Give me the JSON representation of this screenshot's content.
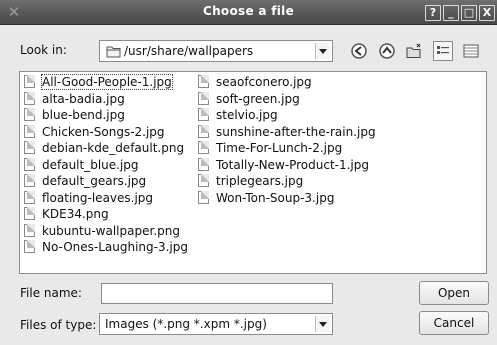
{
  "window": {
    "title": "Choose a file",
    "help": "?",
    "minimize": "_",
    "maximize": "□",
    "close": "X"
  },
  "lookin": {
    "label": "Look in:",
    "path": "/usr/share/wallpapers"
  },
  "files": {
    "col1": [
      "All-Good-People-1.jpg",
      "alta-badia.jpg",
      "blue-bend.jpg",
      "Chicken-Songs-2.jpg",
      "debian-kde_default.png",
      "default_blue.jpg",
      "default_gears.jpg",
      "floating-leaves.jpg",
      "KDE34.png",
      "kubuntu-wallpaper.png",
      "No-Ones-Laughing-3.jpg"
    ],
    "col2": [
      "seaofconero.jpg",
      "soft-green.jpg",
      "stelvio.jpg",
      "sunshine-after-the-rain.jpg",
      "Time-For-Lunch-2.jpg",
      "Totally-New-Product-1.jpg",
      "triplegears.jpg",
      "Won-Ton-Soup-3.jpg"
    ]
  },
  "filename": {
    "label": "File name:",
    "value": ""
  },
  "filetype": {
    "label": "Files of type:",
    "value": "Images (*.png *.xpm *.jpg)"
  },
  "buttons": {
    "open": "Open",
    "cancel": "Cancel"
  }
}
